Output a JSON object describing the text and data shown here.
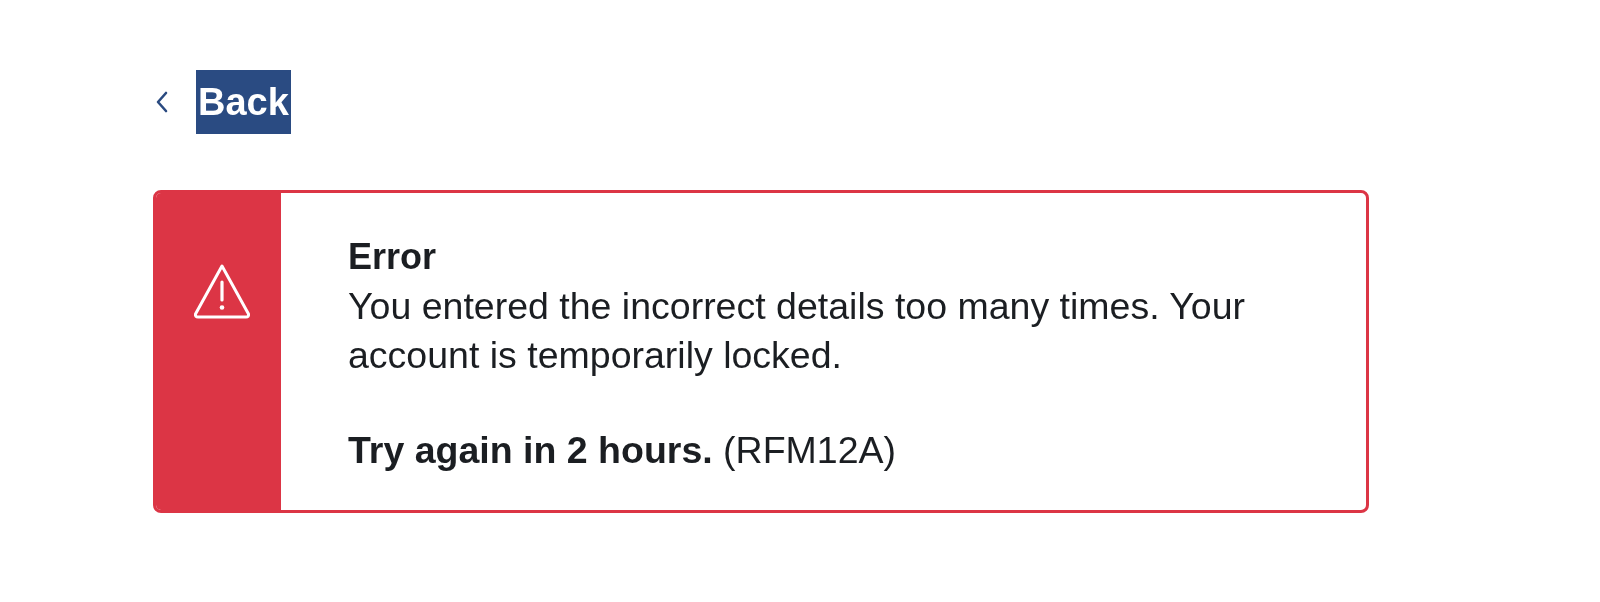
{
  "back_link": {
    "label": "Back",
    "highlighted": true
  },
  "alert": {
    "kind": "error",
    "title": "Error",
    "message": "You entered the incorrect details too many times. Your account is temporarily locked.",
    "note": "**Try again in 2 hours.** (RFM12A)"
  }
}
